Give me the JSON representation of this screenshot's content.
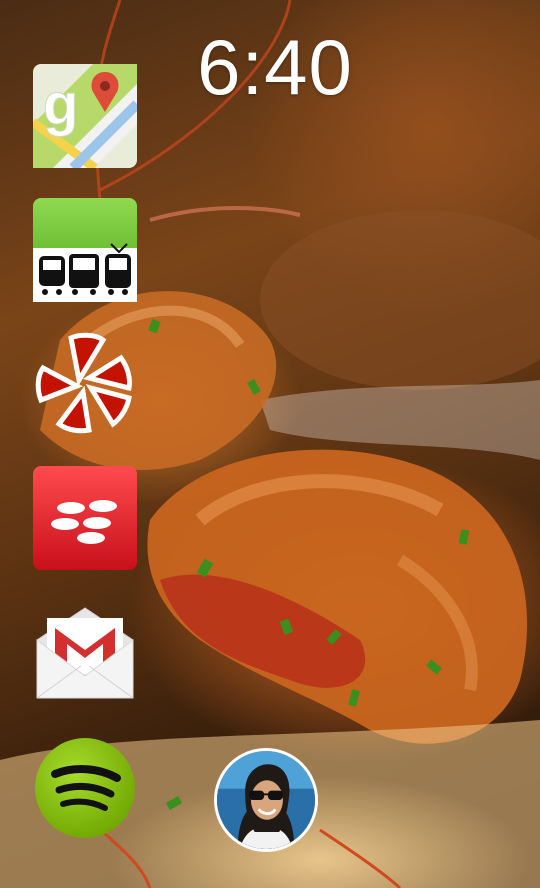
{
  "lockscreen": {
    "time": "6:40",
    "apps": [
      {
        "name": "google-maps",
        "icon": "google-maps-icon"
      },
      {
        "name": "transit",
        "icon": "transit-icon"
      },
      {
        "name": "yelp",
        "icon": "yelp-icon"
      },
      {
        "name": "bbm",
        "icon": "bbm-icon"
      },
      {
        "name": "gmail",
        "icon": "gmail-icon"
      },
      {
        "name": "spotify",
        "icon": "spotify-icon"
      }
    ],
    "contact": {
      "icon": "contact-avatar"
    }
  },
  "colors": {
    "maps_red": "#dd4b39",
    "transit_green": "#6bbf2e",
    "yelp_red": "#c41200",
    "bbm_red": "#e0232b",
    "gmail_red": "#d32f2f",
    "spotify_green": "#84bd00"
  }
}
